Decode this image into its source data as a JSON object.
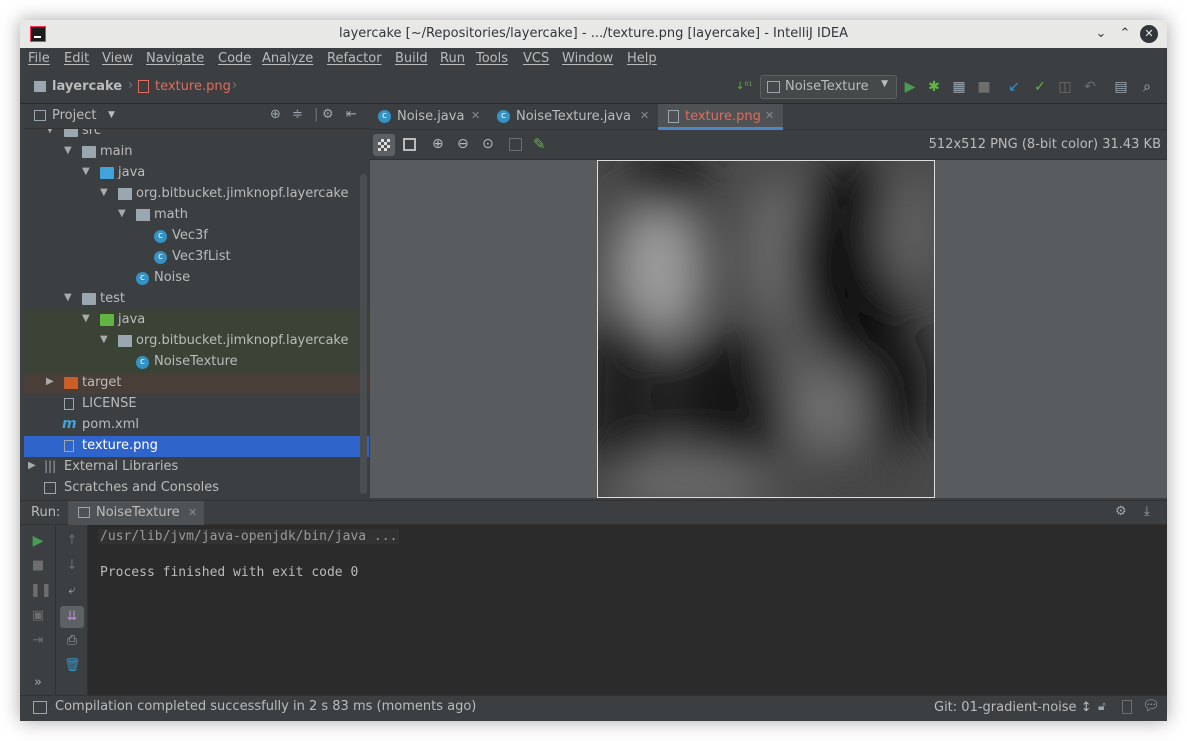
{
  "window": {
    "title": "layercake [~/Repositories/layercake] - .../texture.png [layercake] - IntelliJ IDEA"
  },
  "menu": [
    "File",
    "Edit",
    "View",
    "Navigate",
    "Code",
    "Analyze",
    "Refactor",
    "Build",
    "Run",
    "Tools",
    "VCS",
    "Window",
    "Help"
  ],
  "breadcrumb": {
    "project": "layercake",
    "file": "texture.png"
  },
  "toolbar": {
    "run_config": "NoiseTexture"
  },
  "project_panel": {
    "title": "Project",
    "tree": [
      {
        "label": "src"
      },
      {
        "label": "main"
      },
      {
        "label": "java"
      },
      {
        "label": "org.bitbucket.jimknopf.layercake"
      },
      {
        "label": "math"
      },
      {
        "label": "Vec3f"
      },
      {
        "label": "Vec3fList"
      },
      {
        "label": "Noise"
      },
      {
        "label": "test"
      },
      {
        "label": "java"
      },
      {
        "label": "org.bitbucket.jimknopf.layercake"
      },
      {
        "label": "NoiseTexture"
      },
      {
        "label": "target"
      },
      {
        "label": "LICENSE"
      },
      {
        "label": "pom.xml"
      },
      {
        "label": "texture.png"
      },
      {
        "label": "External Libraries"
      },
      {
        "label": "Scratches and Consoles"
      }
    ]
  },
  "editor": {
    "tabs": [
      {
        "label": "Noise.java"
      },
      {
        "label": "NoiseTexture.java"
      },
      {
        "label": "texture.png"
      }
    ],
    "image_info": "512x512 PNG (8-bit color) 31.43 KB"
  },
  "run": {
    "label": "Run:",
    "tab": "NoiseTexture",
    "console_lines": [
      "/usr/lib/jvm/java-openjdk/bin/java ...",
      "",
      "Process finished with exit code 0"
    ]
  },
  "status": {
    "message": "Compilation completed successfully in 2 s 83 ms (moments ago)",
    "git": "Git: 01-gradient-noise ↕"
  },
  "colors": {
    "accent": "#2f65ca",
    "modified_tab": "#e06c5b",
    "run_green": "#499c54"
  }
}
